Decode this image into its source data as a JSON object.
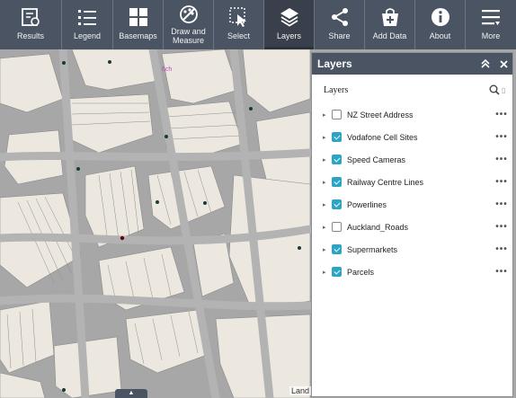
{
  "toolbar": {
    "items": [
      {
        "label": "Results",
        "icon": "results-icon"
      },
      {
        "label": "Legend",
        "icon": "legend-icon"
      },
      {
        "label": "Basemaps",
        "icon": "basemaps-icon"
      },
      {
        "label": "Draw and\nMeasure",
        "icon": "draw-measure-icon"
      },
      {
        "label": "Select",
        "icon": "select-icon"
      },
      {
        "label": "Layers",
        "icon": "layers-icon",
        "active": true
      },
      {
        "label": "Share",
        "icon": "share-icon"
      },
      {
        "label": "Add Data",
        "icon": "add-data-icon"
      },
      {
        "label": "About",
        "icon": "about-icon"
      },
      {
        "label": "More",
        "icon": "more-icon"
      }
    ]
  },
  "panel": {
    "title": "Layers",
    "subtitle": "Layers",
    "layers": [
      {
        "name": "NZ Street Address",
        "checked": false
      },
      {
        "name": "Vodafone Cell Sites",
        "checked": true
      },
      {
        "name": "Speed Cameras",
        "checked": true
      },
      {
        "name": "Railway Centre Lines",
        "checked": true
      },
      {
        "name": "Powerlines",
        "checked": true
      },
      {
        "name": "Auckland_Roads",
        "checked": false
      },
      {
        "name": "Supermarkets",
        "checked": true
      },
      {
        "name": "Parcels",
        "checked": true
      }
    ],
    "more_label": "•••"
  },
  "map": {
    "attribution": "Land",
    "area_label": "6ch",
    "colors": {
      "road": "#a8a8a8",
      "block": "#ede9e1",
      "parcel_line": "#8c8c8c",
      "accent": "#2aa6c4",
      "toolbar": "#4a5463"
    }
  }
}
